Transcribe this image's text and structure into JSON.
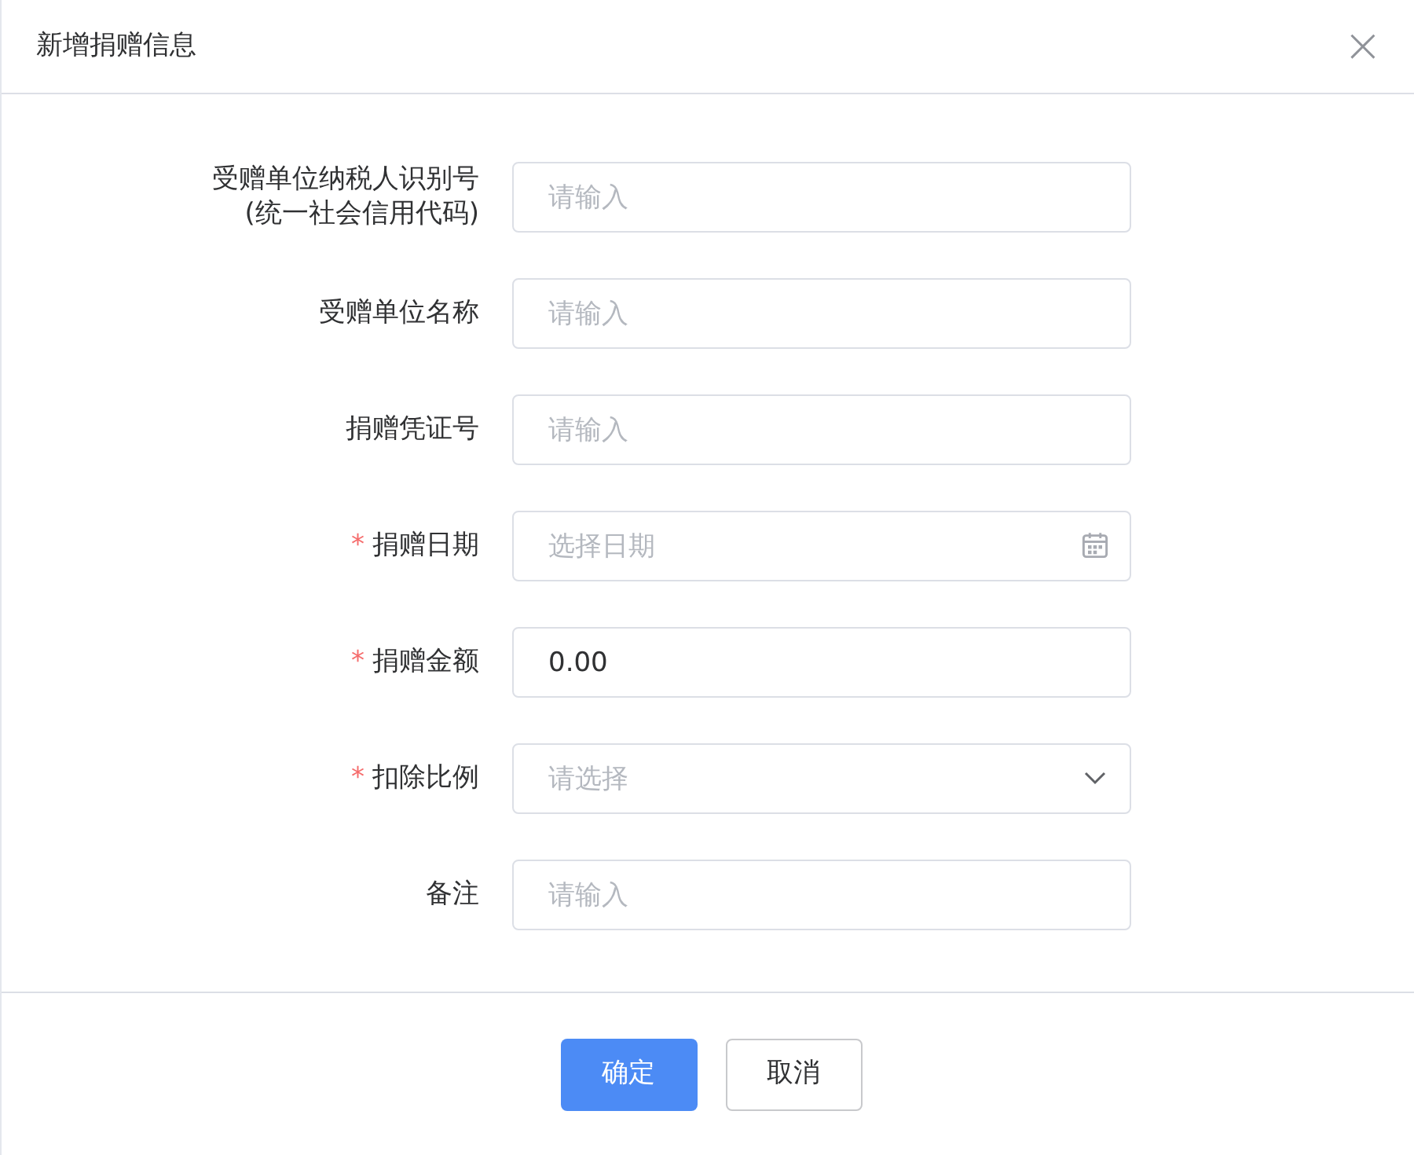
{
  "dialog": {
    "title": "新增捐赠信息",
    "close": "×"
  },
  "fields": [
    {
      "label_lines": [
        "受赠单位纳税人识别号",
        "(统一社会信用代码)"
      ],
      "required": false,
      "kind": "text",
      "placeholder": "请输入"
    },
    {
      "label_lines": [
        "受赠单位名称"
      ],
      "required": false,
      "kind": "text",
      "placeholder": "请输入"
    },
    {
      "label_lines": [
        "捐赠凭证号"
      ],
      "required": false,
      "kind": "text",
      "placeholder": "请输入"
    },
    {
      "label_lines": [
        "捐赠日期"
      ],
      "required": true,
      "kind": "date",
      "placeholder": "选择日期"
    },
    {
      "label_lines": [
        "捐赠金额"
      ],
      "required": true,
      "kind": "text",
      "value": "0.00"
    },
    {
      "label_lines": [
        "扣除比例"
      ],
      "required": true,
      "kind": "select",
      "placeholder": "请选择"
    },
    {
      "label_lines": [
        "备注"
      ],
      "required": false,
      "kind": "text",
      "placeholder": "请输入"
    }
  ],
  "required_mark": "*",
  "buttons": [
    {
      "label": "确定",
      "kind": "primary"
    },
    {
      "label": "取消",
      "kind": "default"
    }
  ]
}
